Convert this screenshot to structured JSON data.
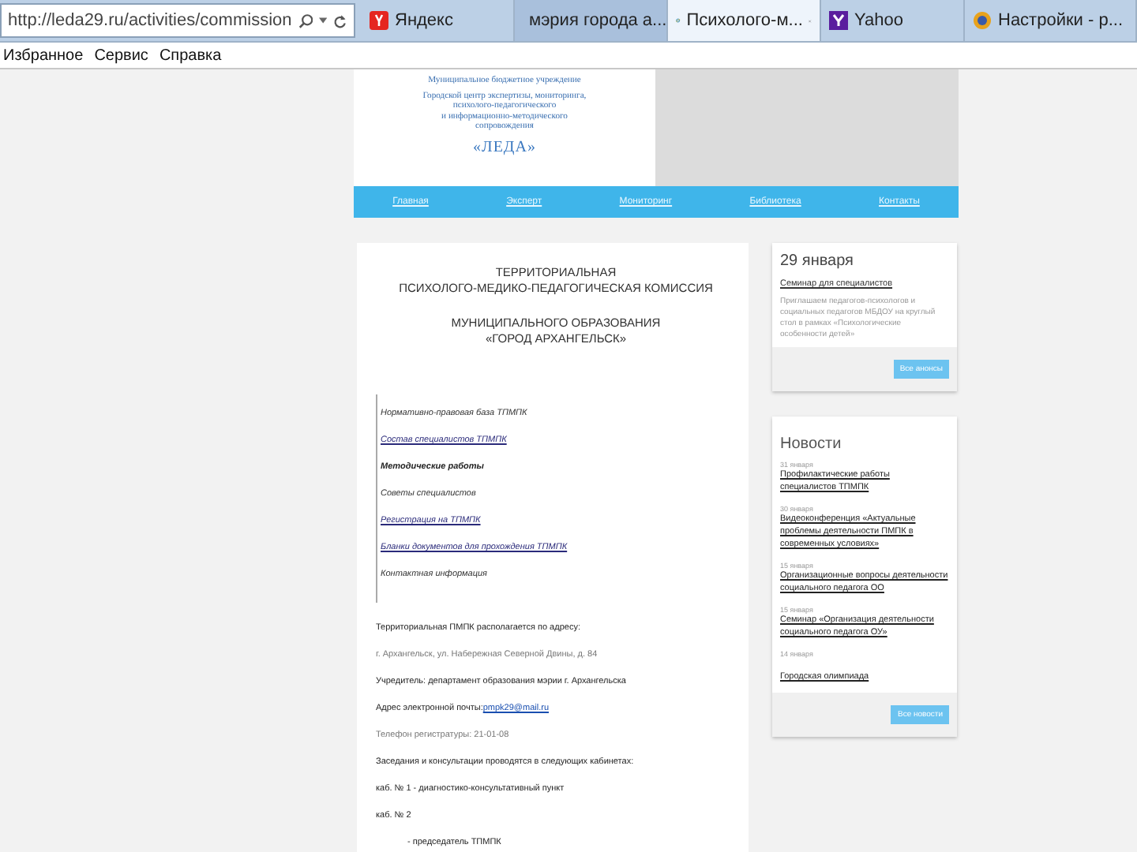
{
  "browser": {
    "address": "http://leda29.ru/activities/commission",
    "tabs": [
      {
        "title": "Яндекс",
        "selected": false,
        "kind": "yandex"
      },
      {
        "title": "мэрия города а...",
        "selected": false,
        "kind": "page"
      },
      {
        "title": "Психолого-м...",
        "selected": true,
        "kind": "ie"
      },
      {
        "title": "Yahoo",
        "selected": false,
        "kind": "yahoo"
      },
      {
        "title": "Настройки - р...",
        "selected": false,
        "kind": "settings"
      }
    ],
    "menu": [
      "Избранное",
      "Сервис",
      "Справка"
    ]
  },
  "header": {
    "lines": [
      "Муниципальное бюджетное учреждение",
      "Городской центр экспертизы, мониторинга,",
      "психолого-педагогического",
      "и информационно-методического",
      "сопровождения"
    ],
    "brand": "«ЛЕДА»"
  },
  "nav": [
    "Главная",
    "Эксперт",
    "Мониторинг",
    "Библиотека",
    "Контакты"
  ],
  "main": {
    "title": [
      "ТЕРРИТОРИАЛЬНАЯ",
      "ПСИХОЛОГО-МЕДИКО-ПЕДАГОГИЧЕСКАЯ КОМИССИЯ"
    ],
    "subtitle": [
      "МУНИЦИПАЛЬНОГО ОБРАЗОВАНИЯ",
      "«ГОРОД АРХАНГЕЛЬСК»"
    ],
    "links": [
      {
        "text": "Нормативно-правовая база ТПМПК",
        "kind": "plain"
      },
      {
        "text": "Состав специалистов ТПМПК",
        "kind": "link"
      },
      {
        "text": "Методические работы",
        "kind": "bold"
      },
      {
        "text": "Советы специалистов",
        "kind": "plain"
      },
      {
        "text": "Регистрация на ТПМПК",
        "kind": "link"
      },
      {
        "text": "Бланки документов для прохождения ТПМПК",
        "kind": "link"
      },
      {
        "text": "Контактная информация",
        "kind": "plain"
      }
    ],
    "paragraphs": [
      {
        "text": "Территориальная ПМПК располагается по адресу:",
        "kind": "text"
      },
      {
        "text": "г. Архангельск, ул. Набережная Северной Двины, д. 84",
        "kind": "faint"
      },
      {
        "text": "Учредитель: департамент образования мэрии г. Архангельска",
        "kind": "text"
      },
      {
        "text": "Адрес электронной почты:",
        "kind": "email",
        "link": "pmpk29@mail.ru"
      },
      {
        "text": "Телефон регистратуры: 21-01-08",
        "kind": "faint"
      },
      {
        "text": "Заседания и консультации проводятся в следующих кабинетах:",
        "kind": "text"
      },
      {
        "text": "каб. № 1 - диагностико-консультативный пункт",
        "kind": "text"
      },
      {
        "text": "каб. № 2",
        "kind": "text"
      },
      {
        "text": "- председатель ТПМПК",
        "kind": "indent"
      }
    ]
  },
  "announcements": {
    "date": "29 января",
    "link": "Семинар для специалистов",
    "text": "Приглашаем педагогов-психологов и социальных педагогов МБДОУ на круглый стол в рамках «Психологические особенности детей»",
    "button": "Все анонсы"
  },
  "news": {
    "title": "Новости",
    "items": [
      {
        "date": "31 января",
        "lines": [
          "Профилактические работы",
          "специалистов ТПМПК"
        ]
      },
      {
        "date": "30 января",
        "lines": [
          "Видеоконференция «Актуальные",
          "проблемы деятельности ПМПК в",
          "современных условиях»"
        ]
      },
      {
        "date": "15 января",
        "lines": [
          "Организационные вопросы деятельности",
          "социального педагога ОО"
        ]
      },
      {
        "date": "15 января",
        "lines": [
          "Семинар «Организация деятельности",
          "социального педагога ОУ»"
        ]
      },
      {
        "date": "14 января",
        "lines": [
          "Городская олимпиада"
        ]
      }
    ],
    "button": "Все новости"
  }
}
